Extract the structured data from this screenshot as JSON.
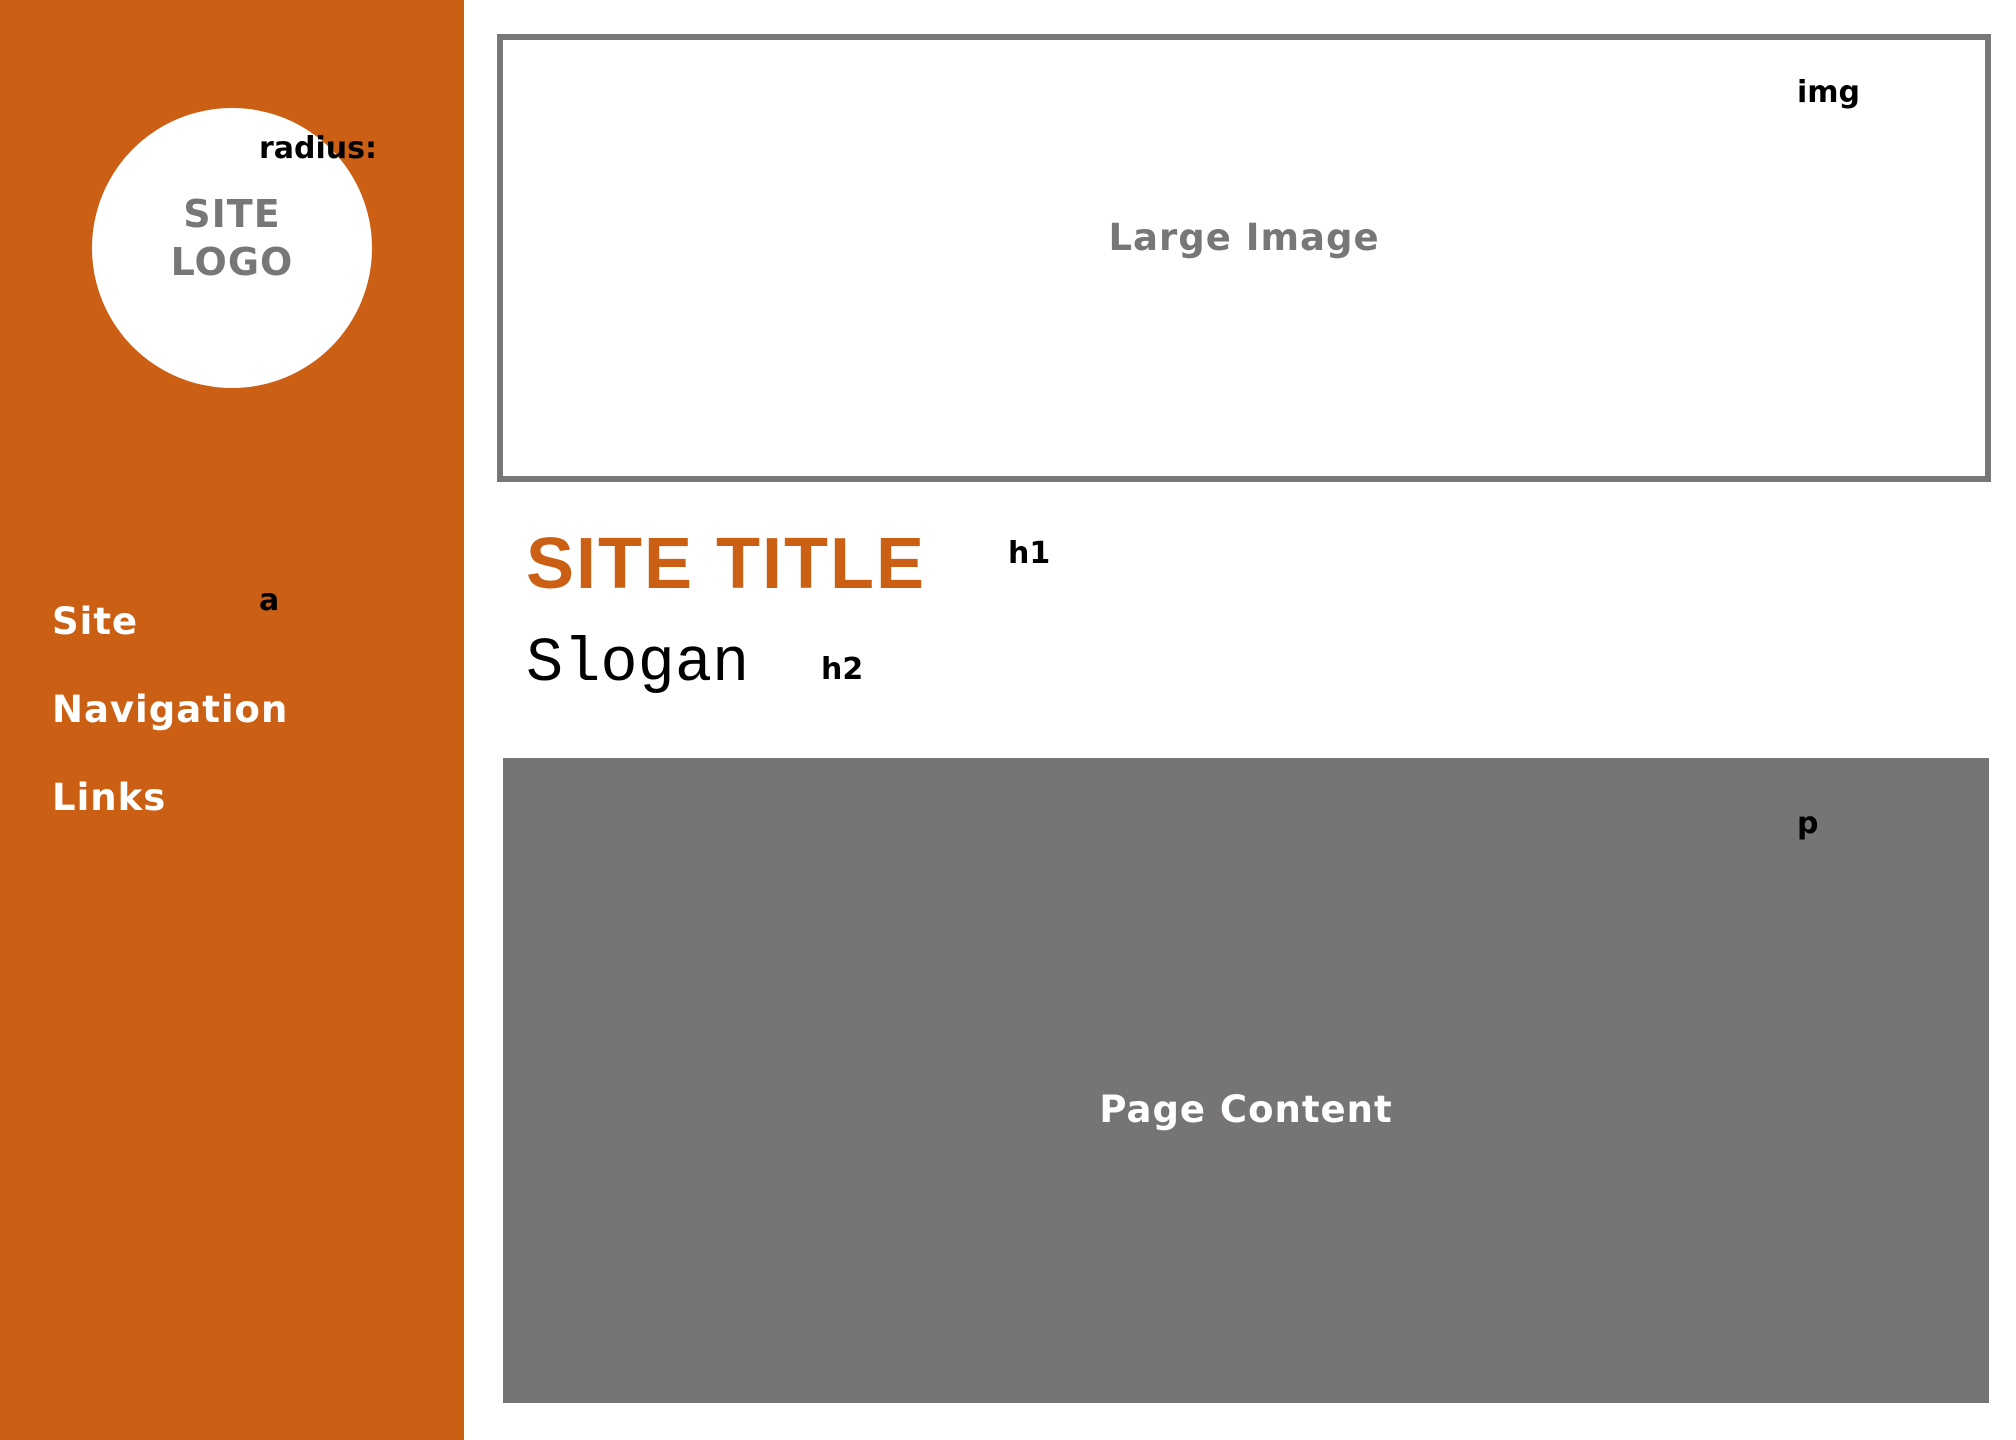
{
  "sidebar": {
    "logo_line1": "SITE",
    "logo_line2": "LOGO",
    "logo_note": "radius:",
    "nav_note": "a",
    "nav_items": [
      "Site",
      "Navigation",
      "Links"
    ]
  },
  "header_image": {
    "label": "Large Image",
    "note": "img"
  },
  "title": {
    "text": "SITE TITLE",
    "note": "h1"
  },
  "slogan": {
    "text": "Slogan",
    "note": "h2"
  },
  "content": {
    "label": "Page Content",
    "note": "p"
  },
  "colors": {
    "accent": "#CB6014",
    "gray": "#777777",
    "content_bg": "#777475",
    "white": "#FFFFFF"
  }
}
